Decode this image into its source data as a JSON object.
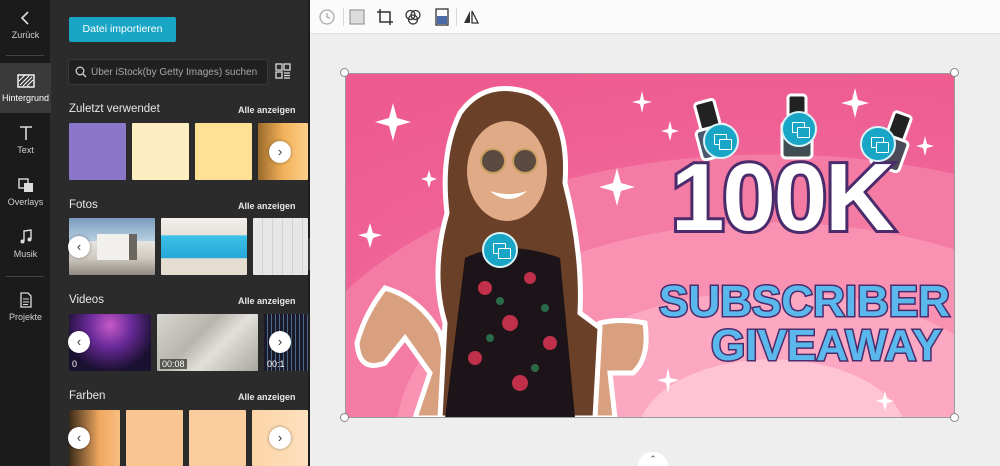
{
  "rail": {
    "items": [
      {
        "label": "Zurück",
        "icon": "back-arrow-icon"
      },
      {
        "label": "Hintergrund",
        "icon": "background-icon"
      },
      {
        "label": "Text",
        "icon": "text-icon"
      },
      {
        "label": "Overlays",
        "icon": "overlays-icon"
      },
      {
        "label": "Musik",
        "icon": "music-icon"
      },
      {
        "label": "Projekte",
        "icon": "projects-icon"
      }
    ]
  },
  "panel": {
    "import_label": "Datei importieren",
    "search_placeholder": "Über iStock(by Getty Images) suchen",
    "sections": {
      "recent": {
        "title": "Zuletzt verwendet",
        "link": "Alle anzeigen"
      },
      "photos": {
        "title": "Fotos",
        "link": "Alle anzeigen"
      },
      "videos": {
        "title": "Videos",
        "link": "Alle anzeigen",
        "durations": [
          "0",
          "00:08",
          "00:1"
        ]
      },
      "colors": {
        "title": "Farben",
        "link": "Alle anzeigen"
      }
    },
    "recent_swatches": [
      "#8b77c9",
      "#fdeec2",
      "#fee195"
    ],
    "color_swatches": [
      "#f9c693",
      "#fbcc9d",
      "#fdd5a8"
    ]
  },
  "toolbar": {
    "icons": [
      "timer-icon",
      "background-fill-icon",
      "crop-icon",
      "filter-icon",
      "opacity-icon",
      "flip-icon"
    ]
  },
  "canvas": {
    "headline": "100K",
    "line1": "SUBSCRIBER",
    "line2": "GIVEAWAY",
    "colors": {
      "bg": "#f06ea0",
      "headline_fill": "#ffffff",
      "headline_stroke": "#4a2b6b",
      "sub_fill": "#5bb8ec",
      "sub_stroke": "#4a2b6b"
    }
  }
}
